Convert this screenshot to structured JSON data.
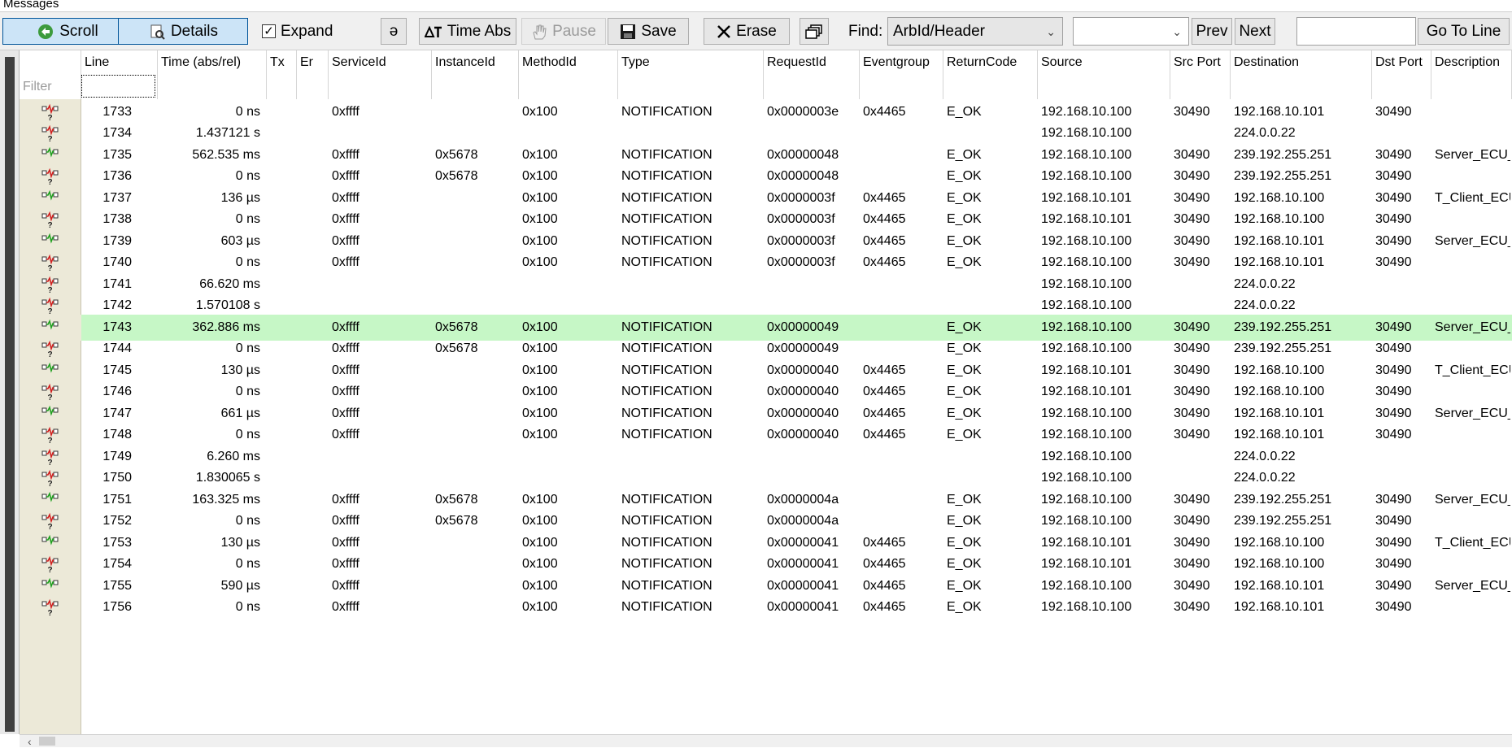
{
  "window": {
    "title": "Messages"
  },
  "toolbar": {
    "scroll_label": "Scroll",
    "details_label": "Details",
    "expand_label": "Expand",
    "expand_checked": "✓",
    "filter_symbol": "ə",
    "time_abs_label": "Time Abs",
    "pause_label": "Pause",
    "save_label": "Save",
    "erase_label": "Erase",
    "find_label": "Find:",
    "find_value": "ArbId/Header",
    "find_text_value": "",
    "prev_label": "Prev",
    "next_label": "Next",
    "goto_value": "",
    "goto_label": "Go To Line"
  },
  "table": {
    "columns": [
      "",
      "Line",
      "Time (abs/rel)",
      "Tx",
      "Er",
      "ServiceId",
      "InstanceId",
      "MethodId",
      "Type",
      "RequestId",
      "Eventgroup",
      "ReturnCode",
      "Source",
      "Src Port",
      "Destination",
      "Dst Port",
      "Description"
    ],
    "filter_placeholder": "Filter",
    "highlight_color": "#c6f7c6",
    "rows": [
      {
        "icon": "error",
        "line": "1733",
        "time": "0 ns",
        "service": "0xffff",
        "instance": "",
        "method": "0x100",
        "type": "NOTIFICATION",
        "request": "0x0000003e",
        "eventgroup": "0x4465",
        "rc": "E_OK",
        "src": "192.168.10.100",
        "sport": "30490",
        "dst": "192.168.10.101",
        "dport": "30490",
        "desc": ""
      },
      {
        "icon": "error",
        "line": "1734",
        "time": "1.437121 s",
        "service": "",
        "instance": "",
        "method": "",
        "type": "",
        "request": "",
        "eventgroup": "",
        "rc": "",
        "src": "192.168.10.100",
        "sport": "",
        "dst": "224.0.0.22",
        "dport": "",
        "desc": ""
      },
      {
        "icon": "ok",
        "line": "1735",
        "time": "562.535 ms",
        "service": "0xffff",
        "instance": "0x5678",
        "method": "0x100",
        "type": "NOTIFICATION",
        "request": "0x00000048",
        "eventgroup": "",
        "rc": "E_OK",
        "src": "192.168.10.100",
        "sport": "30490",
        "dst": "239.192.255.251",
        "dport": "30490",
        "desc": "Server_ECU_"
      },
      {
        "icon": "error",
        "line": "1736",
        "time": "0 ns",
        "service": "0xffff",
        "instance": "0x5678",
        "method": "0x100",
        "type": "NOTIFICATION",
        "request": "0x00000048",
        "eventgroup": "",
        "rc": "E_OK",
        "src": "192.168.10.100",
        "sport": "30490",
        "dst": "239.192.255.251",
        "dport": "30490",
        "desc": ""
      },
      {
        "icon": "ok",
        "line": "1737",
        "time": "136 µs",
        "service": "0xffff",
        "instance": "",
        "method": "0x100",
        "type": "NOTIFICATION",
        "request": "0x0000003f",
        "eventgroup": "0x4465",
        "rc": "E_OK",
        "src": "192.168.10.101",
        "sport": "30490",
        "dst": "192.168.10.100",
        "dport": "30490",
        "desc": "T_Client_ECU"
      },
      {
        "icon": "error",
        "line": "1738",
        "time": "0 ns",
        "service": "0xffff",
        "instance": "",
        "method": "0x100",
        "type": "NOTIFICATION",
        "request": "0x0000003f",
        "eventgroup": "0x4465",
        "rc": "E_OK",
        "src": "192.168.10.101",
        "sport": "30490",
        "dst": "192.168.10.100",
        "dport": "30490",
        "desc": ""
      },
      {
        "icon": "ok",
        "line": "1739",
        "time": "603 µs",
        "service": "0xffff",
        "instance": "",
        "method": "0x100",
        "type": "NOTIFICATION",
        "request": "0x0000003f",
        "eventgroup": "0x4465",
        "rc": "E_OK",
        "src": "192.168.10.100",
        "sport": "30490",
        "dst": "192.168.10.101",
        "dport": "30490",
        "desc": "Server_ECU_"
      },
      {
        "icon": "error",
        "line": "1740",
        "time": "0 ns",
        "service": "0xffff",
        "instance": "",
        "method": "0x100",
        "type": "NOTIFICATION",
        "request": "0x0000003f",
        "eventgroup": "0x4465",
        "rc": "E_OK",
        "src": "192.168.10.100",
        "sport": "30490",
        "dst": "192.168.10.101",
        "dport": "30490",
        "desc": ""
      },
      {
        "icon": "error",
        "line": "1741",
        "time": "66.620 ms",
        "service": "",
        "instance": "",
        "method": "",
        "type": "",
        "request": "",
        "eventgroup": "",
        "rc": "",
        "src": "192.168.10.100",
        "sport": "",
        "dst": "224.0.0.22",
        "dport": "",
        "desc": ""
      },
      {
        "icon": "error",
        "line": "1742",
        "time": "1.570108 s",
        "service": "",
        "instance": "",
        "method": "",
        "type": "",
        "request": "",
        "eventgroup": "",
        "rc": "",
        "src": "192.168.10.100",
        "sport": "",
        "dst": "224.0.0.22",
        "dport": "",
        "desc": ""
      },
      {
        "icon": "ok",
        "line": "1743",
        "time": "362.886 ms",
        "service": "0xffff",
        "instance": "0x5678",
        "method": "0x100",
        "type": "NOTIFICATION",
        "request": "0x00000049",
        "eventgroup": "",
        "rc": "E_OK",
        "src": "192.168.10.100",
        "sport": "30490",
        "dst": "239.192.255.251",
        "dport": "30490",
        "desc": "Server_ECU_",
        "highlight": true
      },
      {
        "icon": "error",
        "line": "1744",
        "time": "0 ns",
        "service": "0xffff",
        "instance": "0x5678",
        "method": "0x100",
        "type": "NOTIFICATION",
        "request": "0x00000049",
        "eventgroup": "",
        "rc": "E_OK",
        "src": "192.168.10.100",
        "sport": "30490",
        "dst": "239.192.255.251",
        "dport": "30490",
        "desc": ""
      },
      {
        "icon": "ok",
        "line": "1745",
        "time": "130 µs",
        "service": "0xffff",
        "instance": "",
        "method": "0x100",
        "type": "NOTIFICATION",
        "request": "0x00000040",
        "eventgroup": "0x4465",
        "rc": "E_OK",
        "src": "192.168.10.101",
        "sport": "30490",
        "dst": "192.168.10.100",
        "dport": "30490",
        "desc": "T_Client_ECU"
      },
      {
        "icon": "error",
        "line": "1746",
        "time": "0 ns",
        "service": "0xffff",
        "instance": "",
        "method": "0x100",
        "type": "NOTIFICATION",
        "request": "0x00000040",
        "eventgroup": "0x4465",
        "rc": "E_OK",
        "src": "192.168.10.101",
        "sport": "30490",
        "dst": "192.168.10.100",
        "dport": "30490",
        "desc": ""
      },
      {
        "icon": "ok",
        "line": "1747",
        "time": "661 µs",
        "service": "0xffff",
        "instance": "",
        "method": "0x100",
        "type": "NOTIFICATION",
        "request": "0x00000040",
        "eventgroup": "0x4465",
        "rc": "E_OK",
        "src": "192.168.10.100",
        "sport": "30490",
        "dst": "192.168.10.101",
        "dport": "30490",
        "desc": "Server_ECU_"
      },
      {
        "icon": "error",
        "line": "1748",
        "time": "0 ns",
        "service": "0xffff",
        "instance": "",
        "method": "0x100",
        "type": "NOTIFICATION",
        "request": "0x00000040",
        "eventgroup": "0x4465",
        "rc": "E_OK",
        "src": "192.168.10.100",
        "sport": "30490",
        "dst": "192.168.10.101",
        "dport": "30490",
        "desc": ""
      },
      {
        "icon": "error",
        "line": "1749",
        "time": "6.260 ms",
        "service": "",
        "instance": "",
        "method": "",
        "type": "",
        "request": "",
        "eventgroup": "",
        "rc": "",
        "src": "192.168.10.100",
        "sport": "",
        "dst": "224.0.0.22",
        "dport": "",
        "desc": ""
      },
      {
        "icon": "error",
        "line": "1750",
        "time": "1.830065 s",
        "service": "",
        "instance": "",
        "method": "",
        "type": "",
        "request": "",
        "eventgroup": "",
        "rc": "",
        "src": "192.168.10.100",
        "sport": "",
        "dst": "224.0.0.22",
        "dport": "",
        "desc": ""
      },
      {
        "icon": "ok",
        "line": "1751",
        "time": "163.325 ms",
        "service": "0xffff",
        "instance": "0x5678",
        "method": "0x100",
        "type": "NOTIFICATION",
        "request": "0x0000004a",
        "eventgroup": "",
        "rc": "E_OK",
        "src": "192.168.10.100",
        "sport": "30490",
        "dst": "239.192.255.251",
        "dport": "30490",
        "desc": "Server_ECU_"
      },
      {
        "icon": "error",
        "line": "1752",
        "time": "0 ns",
        "service": "0xffff",
        "instance": "0x5678",
        "method": "0x100",
        "type": "NOTIFICATION",
        "request": "0x0000004a",
        "eventgroup": "",
        "rc": "E_OK",
        "src": "192.168.10.100",
        "sport": "30490",
        "dst": "239.192.255.251",
        "dport": "30490",
        "desc": ""
      },
      {
        "icon": "ok",
        "line": "1753",
        "time": "130 µs",
        "service": "0xffff",
        "instance": "",
        "method": "0x100",
        "type": "NOTIFICATION",
        "request": "0x00000041",
        "eventgroup": "0x4465",
        "rc": "E_OK",
        "src": "192.168.10.101",
        "sport": "30490",
        "dst": "192.168.10.100",
        "dport": "30490",
        "desc": "T_Client_ECU"
      },
      {
        "icon": "error",
        "line": "1754",
        "time": "0 ns",
        "service": "0xffff",
        "instance": "",
        "method": "0x100",
        "type": "NOTIFICATION",
        "request": "0x00000041",
        "eventgroup": "0x4465",
        "rc": "E_OK",
        "src": "192.168.10.101",
        "sport": "30490",
        "dst": "192.168.10.100",
        "dport": "30490",
        "desc": ""
      },
      {
        "icon": "ok",
        "line": "1755",
        "time": "590 µs",
        "service": "0xffff",
        "instance": "",
        "method": "0x100",
        "type": "NOTIFICATION",
        "request": "0x00000041",
        "eventgroup": "0x4465",
        "rc": "E_OK",
        "src": "192.168.10.100",
        "sport": "30490",
        "dst": "192.168.10.101",
        "dport": "30490",
        "desc": "Server_ECU_"
      },
      {
        "icon": "error",
        "line": "1756",
        "time": "0 ns",
        "service": "0xffff",
        "instance": "",
        "method": "0x100",
        "type": "NOTIFICATION",
        "request": "0x00000041",
        "eventgroup": "0x4465",
        "rc": "E_OK",
        "src": "192.168.10.100",
        "sport": "30490",
        "dst": "192.168.10.101",
        "dport": "30490",
        "desc": ""
      }
    ]
  }
}
